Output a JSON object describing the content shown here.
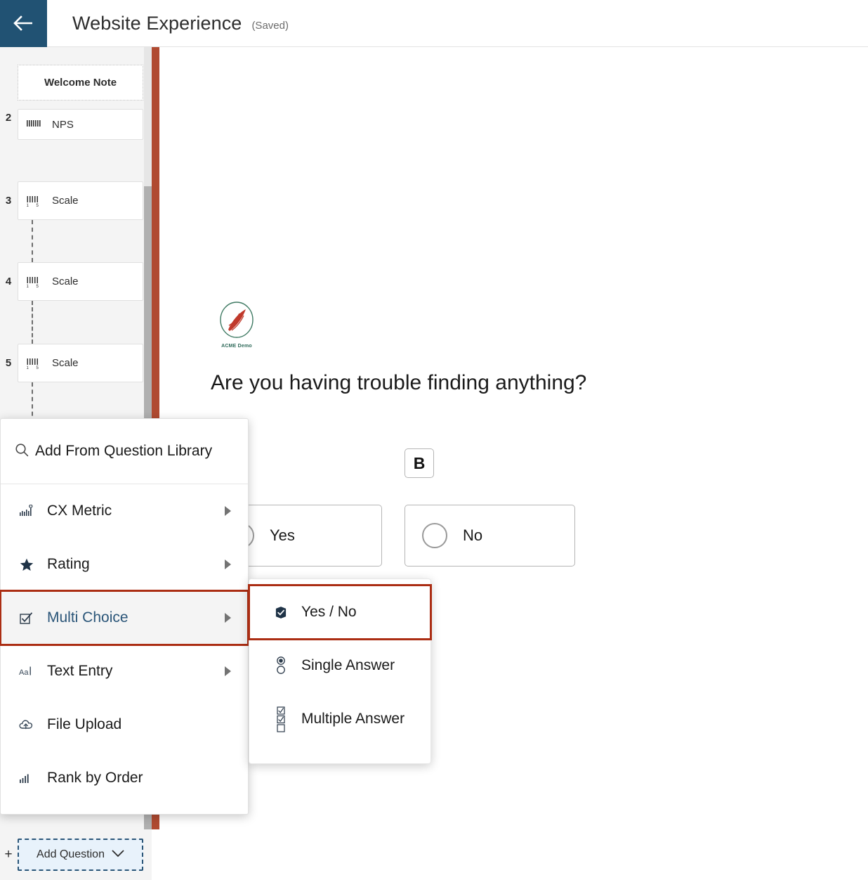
{
  "header": {
    "back_icon": "arrow-left-icon",
    "title": "Website Experience",
    "status": "(Saved)"
  },
  "sidebar": {
    "welcome_note": "Welcome Note",
    "branch_icon": "branching-logic-icon",
    "items": [
      {
        "number": "2",
        "label": "NPS",
        "icon": "nps-scale-icon"
      },
      {
        "number": "3",
        "label": "Scale",
        "icon": "scale-icon"
      },
      {
        "number": "4",
        "label": "Scale",
        "icon": "scale-icon"
      },
      {
        "number": "5",
        "label": "Scale",
        "icon": "scale-icon"
      }
    ],
    "add_question": {
      "plus": "+",
      "label": "Add Question",
      "chevron_icon": "chevron-down-icon"
    }
  },
  "canvas": {
    "logo_caption": "ACME Demo",
    "logo_icon": "acme-demo-logo",
    "question": "Are you having trouble finding anything?",
    "badge": "B",
    "choices": [
      {
        "label": "Yes"
      },
      {
        "label": "No"
      }
    ]
  },
  "menu": {
    "search_icon": "search-icon",
    "header_label": "Add From Question Library",
    "items": [
      {
        "label": "CX Metric",
        "icon": "cx-metric-icon",
        "has_arrow": true,
        "selected": false
      },
      {
        "label": "Rating",
        "icon": "star-icon",
        "has_arrow": true,
        "selected": false
      },
      {
        "label": "Multi Choice",
        "icon": "checkbox-icon",
        "has_arrow": true,
        "selected": true
      },
      {
        "label": "Text Entry",
        "icon": "text-entry-icon",
        "has_arrow": true,
        "selected": false
      },
      {
        "label": "File Upload",
        "icon": "cloud-upload-icon",
        "has_arrow": false,
        "selected": false
      },
      {
        "label": "Rank by Order",
        "icon": "rank-bars-icon",
        "has_arrow": false,
        "selected": false
      }
    ]
  },
  "submenu": {
    "items": [
      {
        "label": "Yes / No",
        "icon": "check-badge-icon",
        "selected": true
      },
      {
        "label": "Single Answer",
        "icon": "radio-list-icon",
        "selected": false
      },
      {
        "label": "Multiple Answer",
        "icon": "checkbox-list-icon",
        "selected": false
      }
    ]
  },
  "colors": {
    "header_accent": "#215273",
    "highlight_red": "#ab2d13",
    "side_bar_red": "#b04a31",
    "link_blue": "#2a5578",
    "add_question_bg": "#e8f2fb"
  }
}
